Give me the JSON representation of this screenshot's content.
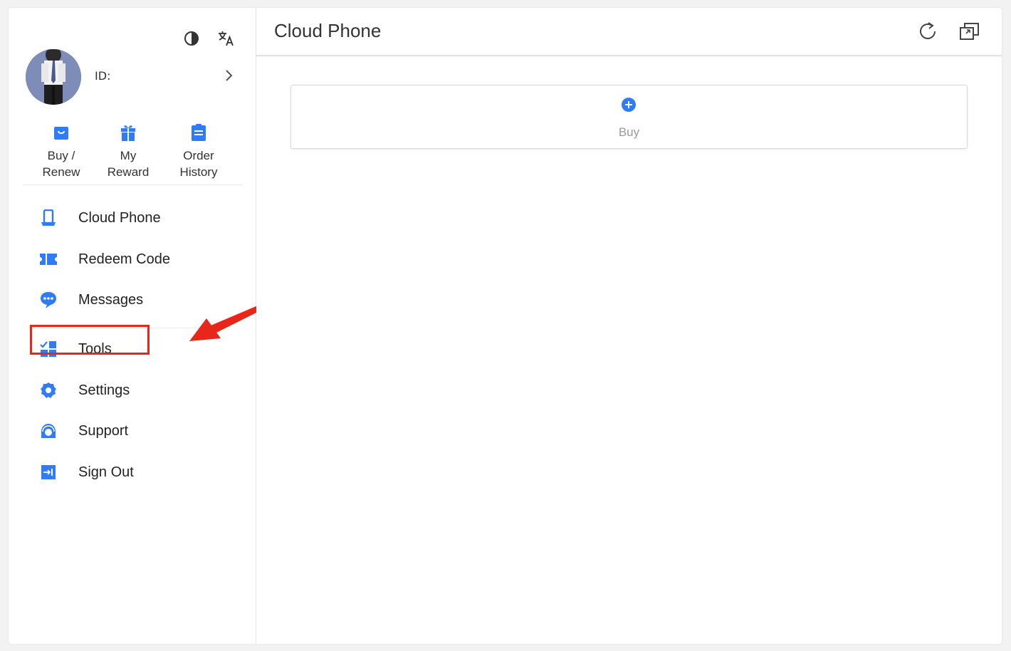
{
  "colors": {
    "accent": "#2f7cf6",
    "highlight": "#e8271a",
    "text": "#333333",
    "muted": "#9a9a9a"
  },
  "sidebar": {
    "top_icons": [
      {
        "icon": "theme-toggle-icon"
      },
      {
        "icon": "translate-icon"
      }
    ],
    "profile": {
      "id_label": "ID:"
    },
    "quick_actions": [
      {
        "label": "Buy /\nRenew",
        "icon": "shopping-bag-icon"
      },
      {
        "label": "My\nReward",
        "icon": "gift-icon"
      },
      {
        "label": "Order\nHistory",
        "icon": "clipboard-icon"
      }
    ],
    "menu": [
      {
        "label": "Cloud Phone",
        "icon": "cloud-phone-icon"
      },
      {
        "label": "Redeem Code",
        "icon": "ticket-icon"
      },
      {
        "label": "Messages",
        "icon": "chat-bubble-icon"
      },
      {
        "label": "Tools",
        "icon": "tools-grid-icon"
      },
      {
        "label": "Settings",
        "icon": "gear-icon"
      },
      {
        "label": "Support",
        "icon": "headset-icon"
      },
      {
        "label": "Sign Out",
        "icon": "sign-out-icon"
      }
    ]
  },
  "main": {
    "title": "Cloud Phone",
    "header_icons": [
      "refresh-icon",
      "window-switch-icon"
    ],
    "buy_card": {
      "label": "Buy",
      "icon": "plus-circle-icon"
    }
  },
  "annotation": {
    "highlighted_item": "Tools"
  }
}
